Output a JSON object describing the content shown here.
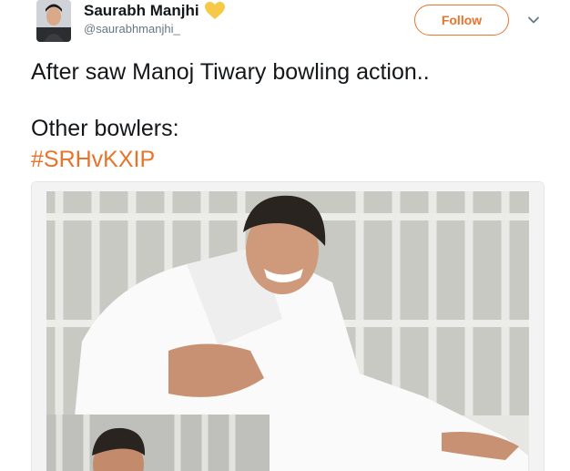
{
  "user": {
    "display_name": "Saurabh Manjhi",
    "handle": "@saurabhmanjhi_"
  },
  "follow_label": "Follow",
  "tweet": {
    "line1": "After saw Manoj Tiwary bowling action..",
    "line2": "Other bowlers:",
    "hashtag": "#SRHvKXIP"
  },
  "icons": {
    "badge": "yellow-heart-icon",
    "menu": "chevron-down-icon"
  },
  "colors": {
    "accent": "#e8742b",
    "text": "#14171a",
    "secondary": "#657786",
    "heart": "#f7c948"
  }
}
